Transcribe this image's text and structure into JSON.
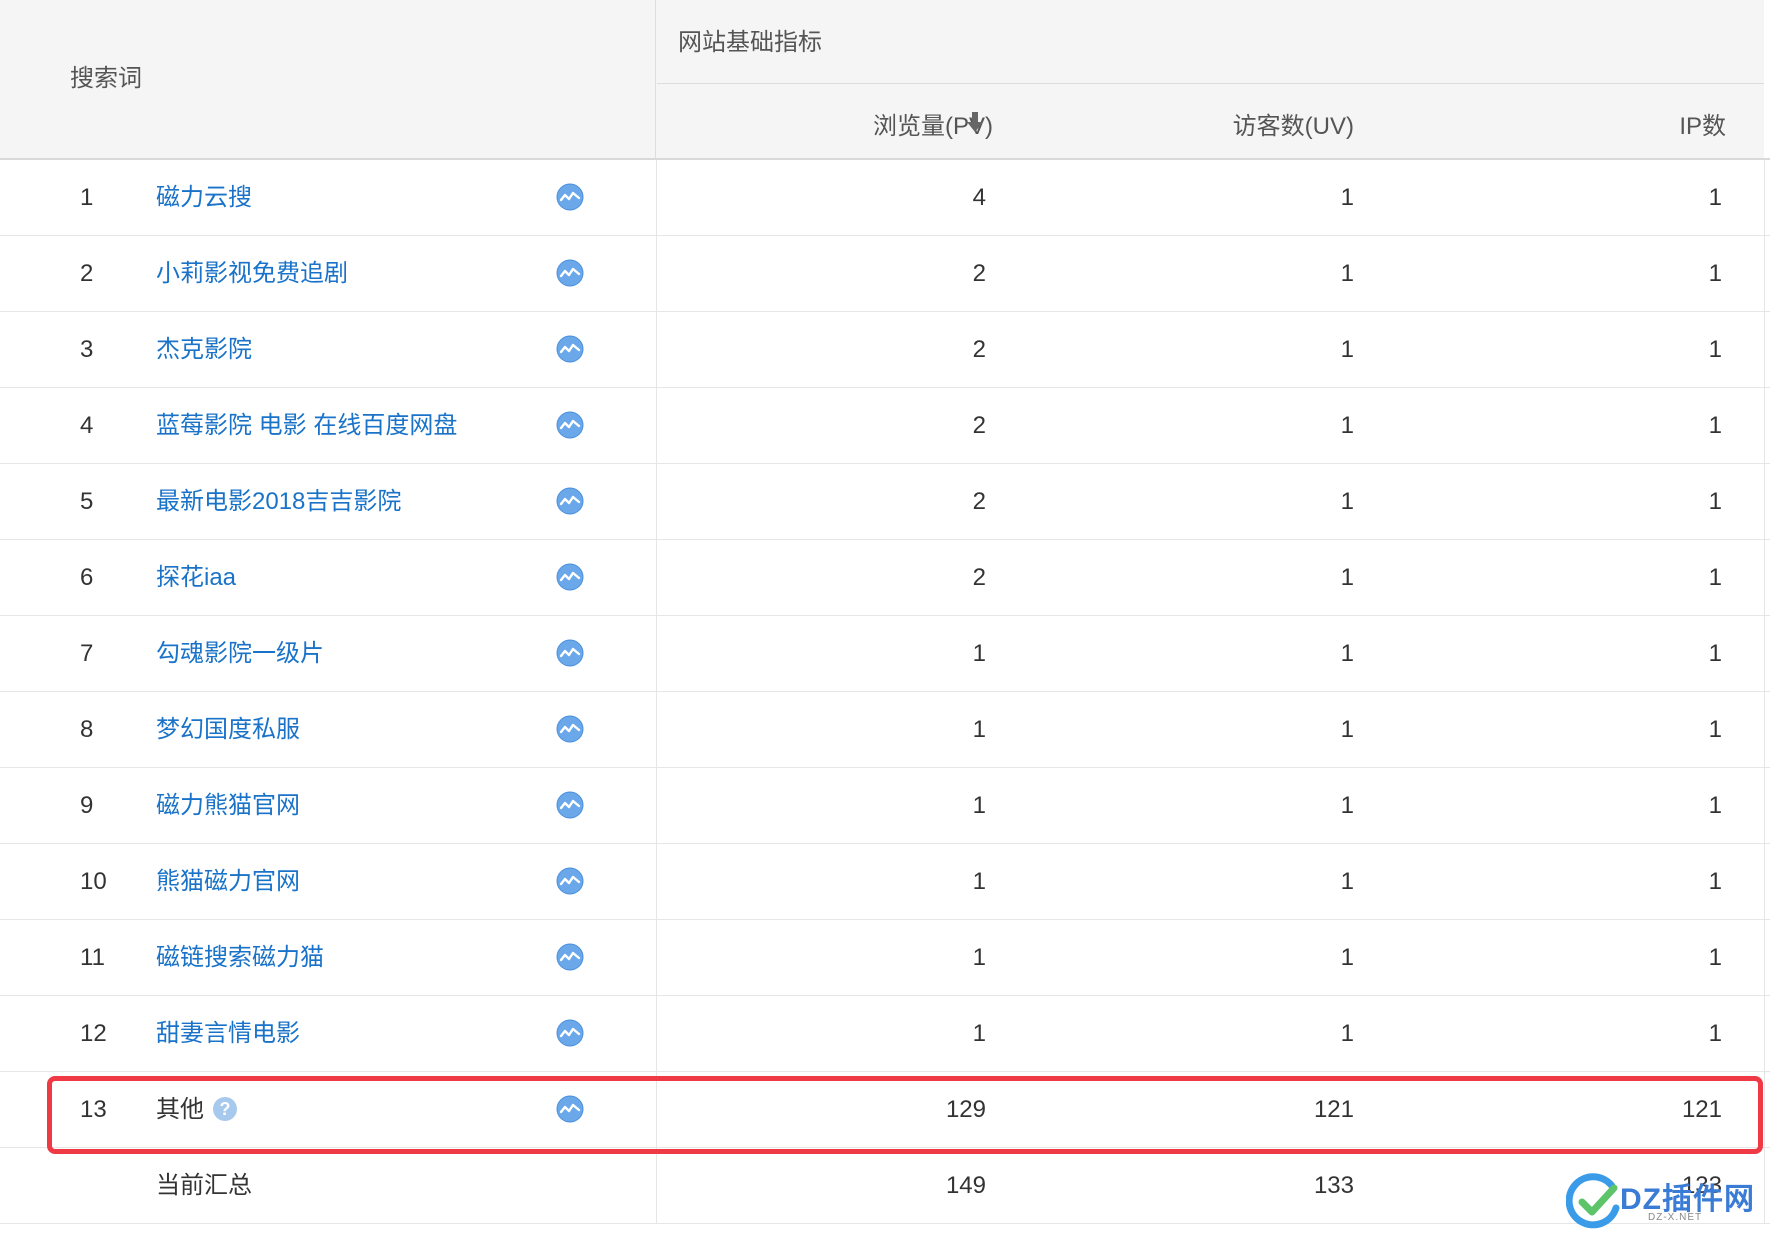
{
  "header": {
    "keyword_col": "搜索词",
    "group_title": "网站基础指标",
    "pv": "浏览量(PV)",
    "uv": "访客数(UV)",
    "ip": "IP数",
    "sort_icon": "arrow-down-icon"
  },
  "rows": [
    {
      "rank": "1",
      "keyword": "磁力云搜",
      "pv": "4",
      "uv": "1",
      "ip": "1"
    },
    {
      "rank": "2",
      "keyword": "小莉影视免费追剧",
      "pv": "2",
      "uv": "1",
      "ip": "1"
    },
    {
      "rank": "3",
      "keyword": "杰克影院",
      "pv": "2",
      "uv": "1",
      "ip": "1"
    },
    {
      "rank": "4",
      "keyword": "蓝莓影院 电影 在线百度网盘",
      "pv": "2",
      "uv": "1",
      "ip": "1"
    },
    {
      "rank": "5",
      "keyword": "最新电影2018吉吉影院",
      "pv": "2",
      "uv": "1",
      "ip": "1"
    },
    {
      "rank": "6",
      "keyword": "探花iaa",
      "pv": "2",
      "uv": "1",
      "ip": "1"
    },
    {
      "rank": "7",
      "keyword": "勾魂影院一级片",
      "pv": "1",
      "uv": "1",
      "ip": "1"
    },
    {
      "rank": "8",
      "keyword": "梦幻国度私服",
      "pv": "1",
      "uv": "1",
      "ip": "1"
    },
    {
      "rank": "9",
      "keyword": "磁力熊猫官网",
      "pv": "1",
      "uv": "1",
      "ip": "1"
    },
    {
      "rank": "10",
      "keyword": "熊猫磁力官网",
      "pv": "1",
      "uv": "1",
      "ip": "1"
    },
    {
      "rank": "11",
      "keyword": "磁链搜索磁力猫",
      "pv": "1",
      "uv": "1",
      "ip": "1"
    },
    {
      "rank": "12",
      "keyword": "甜妻言情电影",
      "pv": "1",
      "uv": "1",
      "ip": "1"
    },
    {
      "rank": "13",
      "keyword": "其他",
      "pv": "129",
      "uv": "121",
      "ip": "121"
    }
  ],
  "summary": {
    "label": "当前汇总",
    "pv": "149",
    "uv": "133",
    "ip": "133"
  },
  "help_glyph": "?",
  "watermark": {
    "text": "DZ插件网",
    "sub": "DZ-X.NET"
  },
  "colors": {
    "link": "#1a73c8",
    "highlight": "#ef3a46",
    "trend_icon": "#6aa8ea"
  }
}
